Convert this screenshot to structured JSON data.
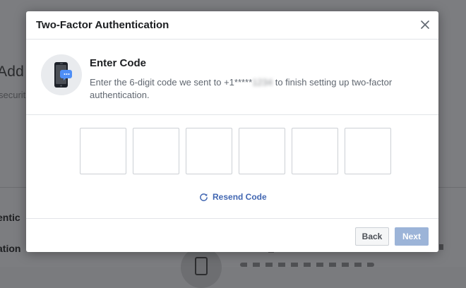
{
  "background": {
    "heading": "Add",
    "subtext": "securit",
    "item_one": "entic",
    "item_two": "ation"
  },
  "dialog": {
    "title": "Two-Factor Authentication",
    "close_icon": "close-icon"
  },
  "info": {
    "icon": "phone-message-icon",
    "title": "Enter Code",
    "description_before": "Enter the 6-digit code we sent to ",
    "phone_visible": "+1*****",
    "phone_masked": "1234",
    "description_after": " to finish setting up two-factor authentication."
  },
  "code_inputs": [
    "",
    "",
    "",
    "",
    "",
    ""
  ],
  "resend": {
    "icon": "refresh-icon",
    "label": "Resend Code"
  },
  "footer": {
    "back_label": "Back",
    "next_label": "Next"
  },
  "colors": {
    "accent": "#4267b2",
    "next_disabled": "#9cb4d8",
    "border": "#ccd0d5"
  }
}
